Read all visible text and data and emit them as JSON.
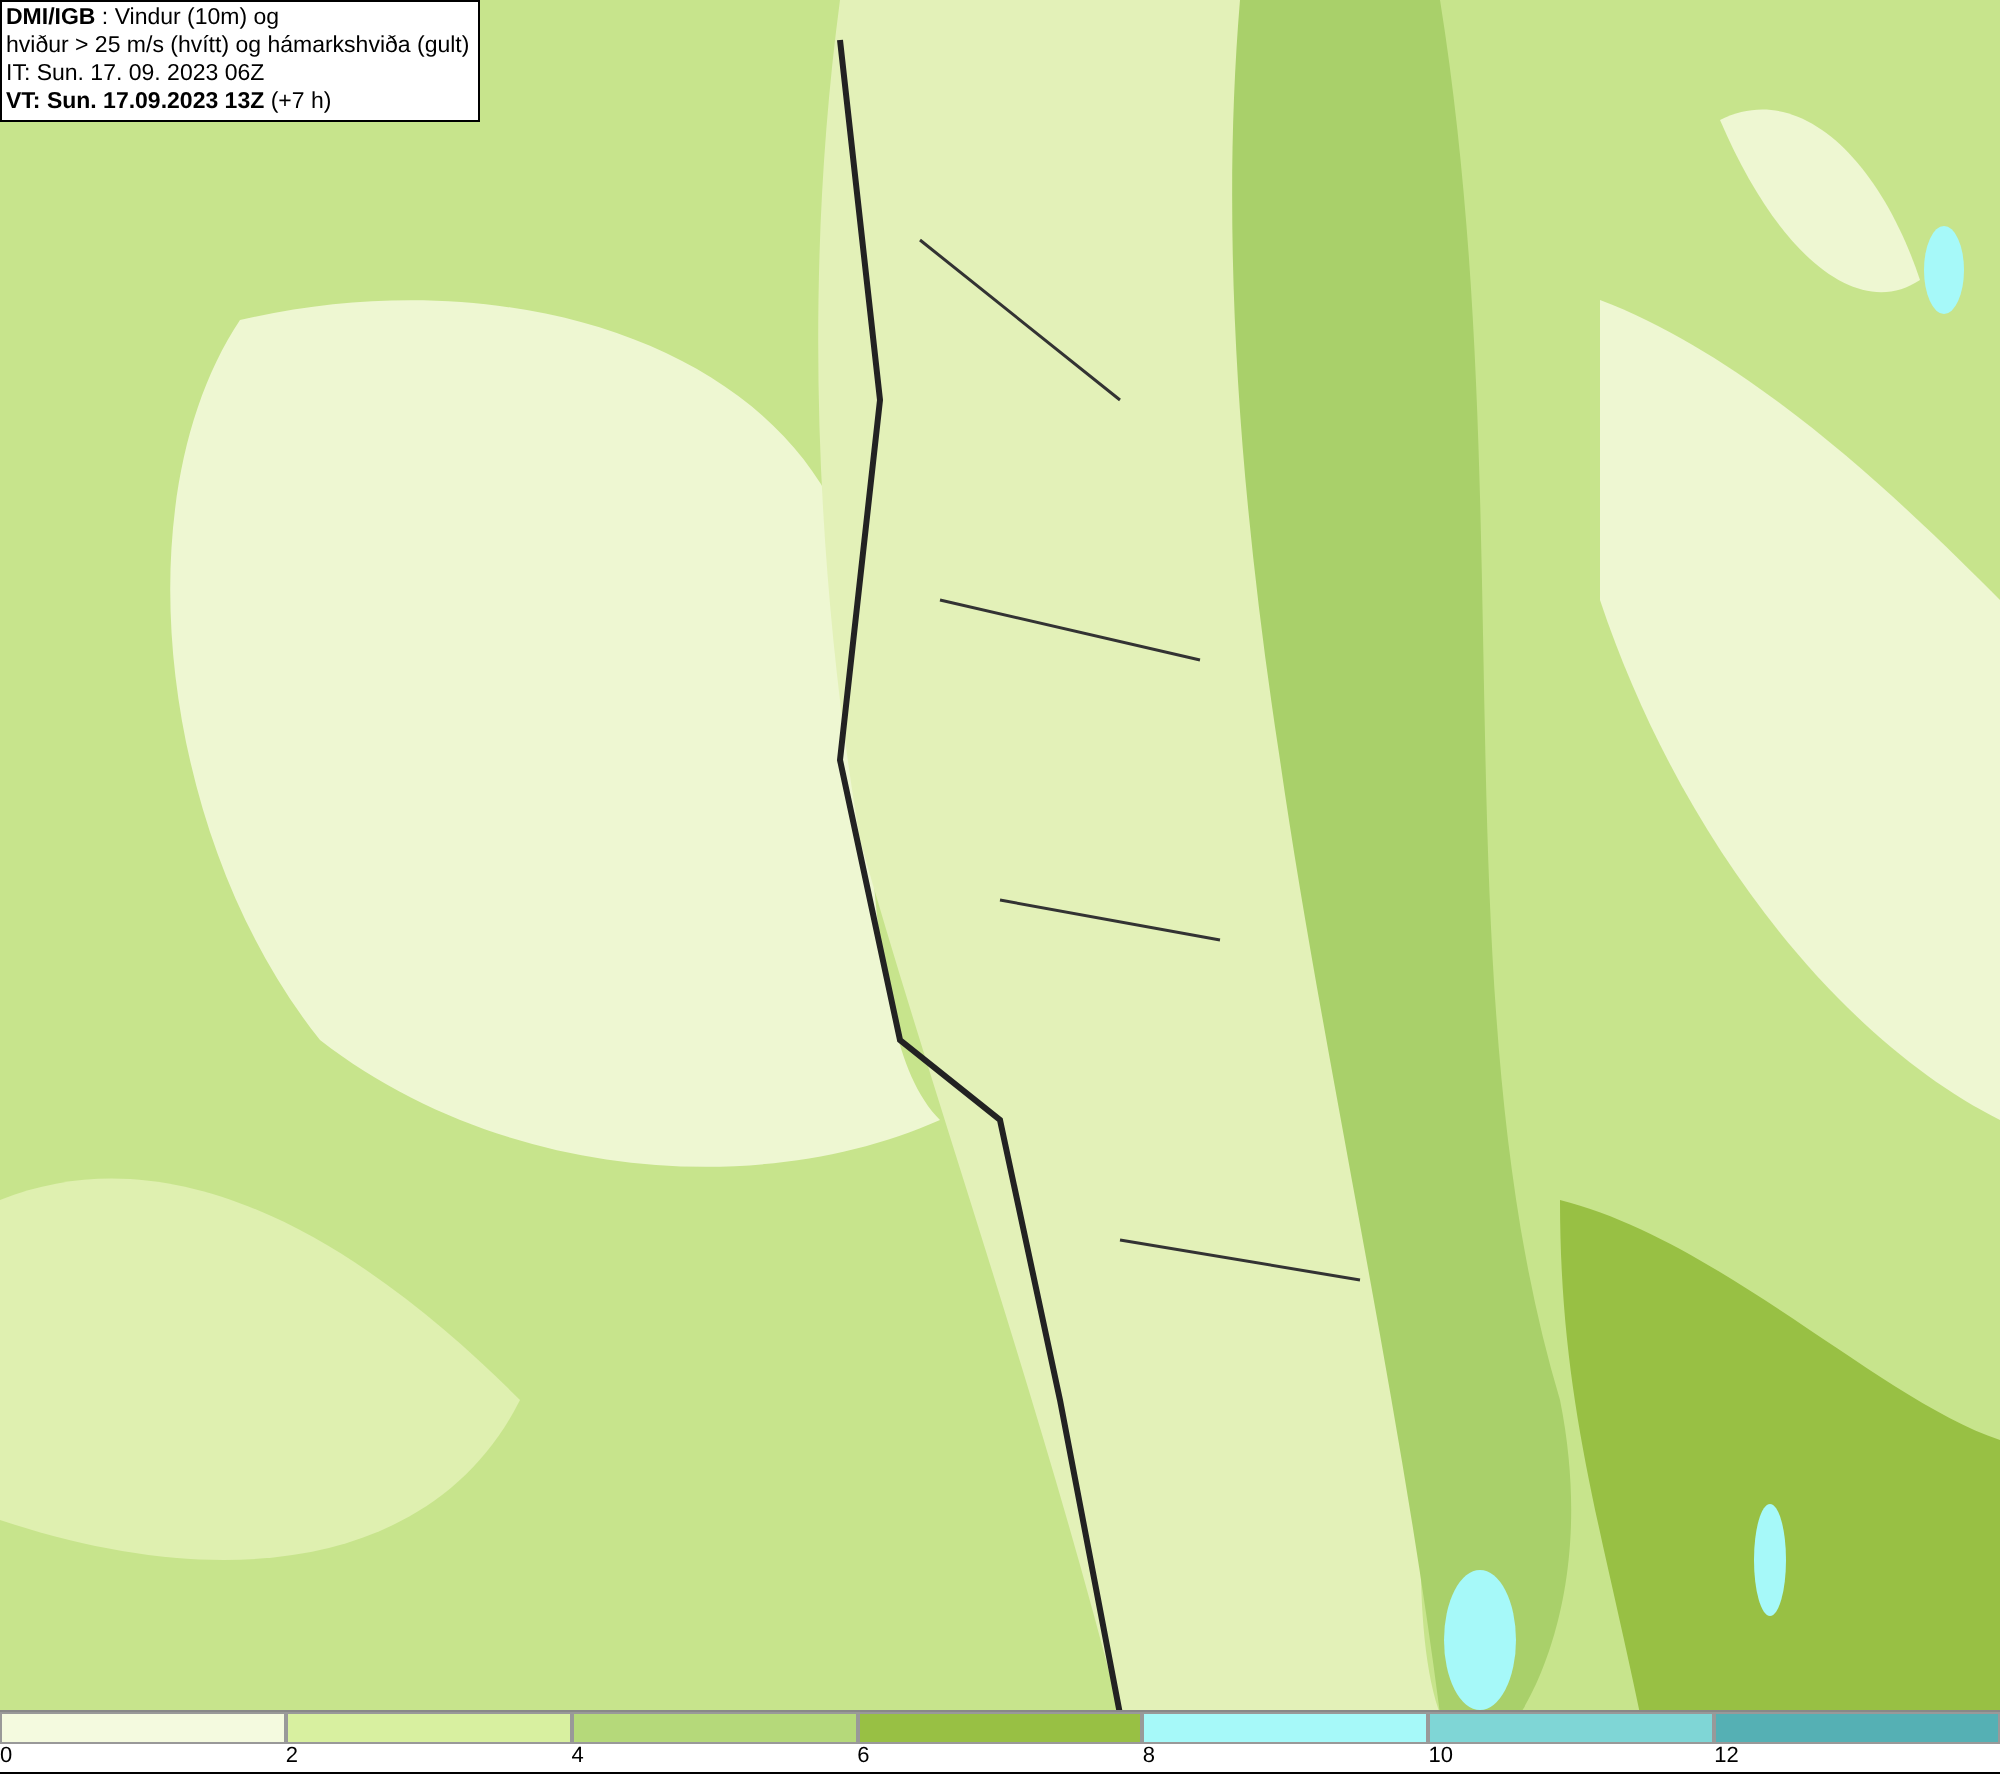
{
  "header": {
    "lines": [
      "**DMI/IGB** : Vindur (10m) og",
      "hviður > 25 m/s (hvítt) og hámarkshviða (gult)",
      "IT: Sun. 17. 09. 2023 06Z",
      "**VT: Sun. 17.09.2023 13Z** (+7 h)"
    ]
  },
  "legend": [
    {
      "label": "0",
      "color": "#f4fadf"
    },
    {
      "label": "2",
      "color": "#d8f0a0"
    },
    {
      "label": "4",
      "color": "#b5d97a"
    },
    {
      "label": "6",
      "color": "#98c044"
    },
    {
      "label": "8",
      "color": "#a6f9f9"
    },
    {
      "label": "10",
      "color": "#7fd6d6"
    },
    {
      "label": "12",
      "color": "#55b0b4"
    }
  ]
}
